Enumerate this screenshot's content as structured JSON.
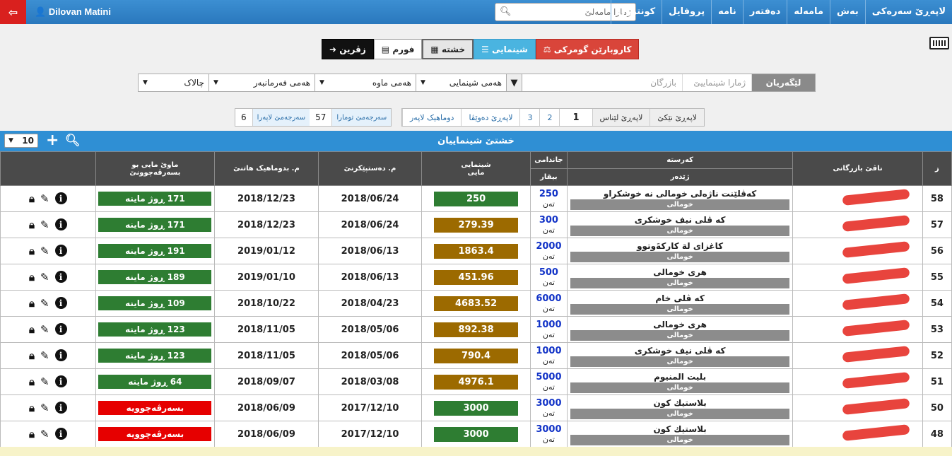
{
  "topnav": {
    "user": "Dilovan Matini",
    "items": [
      "لاپەڕێ سەرەکی",
      "بەش",
      "مامەلە",
      "دەفتەر",
      "نامە",
      "پروفایل",
      "کونترول"
    ],
    "search_placeholder": "ژمارا مامەلێ"
  },
  "buttons": {
    "back": "زڤرین",
    "form": "فورم",
    "table": "خشتە",
    "show": "شینمایی",
    "customs": "کاروبارێن گومرکی"
  },
  "filters": {
    "search_btn": "لێگەریان",
    "show_no_placeholder": "ژمارا شینماییێ",
    "merchant_placeholder": "بازرگان",
    "all_show": "هەمی شینمایی",
    "all_period": "هەمی ماوە",
    "all_director": "هەمی فەرمانبەر",
    "status": "چالاک"
  },
  "pager": {
    "next": "لاپەڕێ نێکێ",
    "prev": "لاپەڕێ لێناس",
    "pages": [
      "1",
      "2",
      "3"
    ],
    "last_prev": "لاپەڕێ دەوێڤا",
    "last": "دوماهیک لاپەر"
  },
  "stats": {
    "total_records_label": "سەرجەمێ تومارا",
    "total_records": "57",
    "total_pages_label": "سەرجەمێ لاپەرا",
    "total_pages": "6"
  },
  "panel": {
    "title": "خشتێ شینماییان",
    "page_size": "10"
  },
  "columns": {
    "num": "ز",
    "merchant": "ناڤێ بازرگانی",
    "goods": "کەرستە",
    "goods_sub": "ژێدەر",
    "qty": "جاندامی",
    "qty_sub": "بیقار",
    "color": "شینمایی",
    "color_sub": "مایی",
    "start": "م. دەستپێکرنێ",
    "end": "م. بدوماهیک هاتنێ",
    "remain": "ماوێ مایی بو",
    "remain_sub": "بسەرڤەچوونێ"
  },
  "rows": [
    {
      "num": "58",
      "goods": "کەڤلێنت ناژەلی خومالی نە خوشکراو",
      "type": "خومالی",
      "qty": "250",
      "unit": "تەن",
      "value": "250",
      "color": "#2e7d32",
      "start": "2018/06/24",
      "end": "2018/12/23",
      "remain": "171 ڕوژ ماینە",
      "remain_color": "#2e7d32"
    },
    {
      "num": "57",
      "goods": "کە ڤلی نیف خوشکری",
      "type": "خومالی",
      "qty": "300",
      "unit": "تەن",
      "value": "279.39",
      "color": "#9c6a00",
      "start": "2018/06/24",
      "end": "2018/12/23",
      "remain": "171 ڕوژ ماینە",
      "remain_color": "#2e7d32"
    },
    {
      "num": "56",
      "goods": "کاغزای لەَ کارکةَوتوو",
      "type": "خومالی",
      "qty": "2000",
      "unit": "تەن",
      "value": "1863.4",
      "color": "#9c6a00",
      "start": "2018/06/13",
      "end": "2019/01/12",
      "remain": "191 ڕوژ ماینە",
      "remain_color": "#2e7d32"
    },
    {
      "num": "55",
      "goods": "هری خومالی",
      "type": "خومالی",
      "qty": "500",
      "unit": "تەن",
      "value": "451.96",
      "color": "#9c6a00",
      "start": "2018/06/13",
      "end": "2019/01/10",
      "remain": "189 ڕوژ ماینە",
      "remain_color": "#2e7d32"
    },
    {
      "num": "54",
      "goods": "کە ڤلی خام",
      "type": "خومالی",
      "qty": "6000",
      "unit": "تەن",
      "value": "4683.52",
      "color": "#9c6a00",
      "start": "2018/04/23",
      "end": "2018/10/22",
      "remain": "109 ڕوژ ماینە",
      "remain_color": "#2e7d32"
    },
    {
      "num": "53",
      "goods": "هری خومالی",
      "type": "خومالی",
      "qty": "1000",
      "unit": "تەن",
      "value": "892.38",
      "color": "#9c6a00",
      "start": "2018/05/06",
      "end": "2018/11/05",
      "remain": "123 ڕوژ ماینە",
      "remain_color": "#2e7d32"
    },
    {
      "num": "52",
      "goods": "کە ڤلی نیف خوشکری",
      "type": "خومالی",
      "qty": "1000",
      "unit": "تەن",
      "value": "790.4",
      "color": "#9c6a00",
      "start": "2018/05/06",
      "end": "2018/11/05",
      "remain": "123 ڕوژ ماینە",
      "remain_color": "#2e7d32"
    },
    {
      "num": "51",
      "goods": "بليت المنيوم",
      "type": "خومالی",
      "qty": "5000",
      "unit": "تەن",
      "value": "4976.1",
      "color": "#9c6a00",
      "start": "2018/03/08",
      "end": "2018/09/07",
      "remain": "64 ڕوژ ماینە",
      "remain_color": "#2e7d32"
    },
    {
      "num": "50",
      "goods": "بلاستيك كون",
      "type": "خومالی",
      "qty": "3000",
      "unit": "تەن",
      "value": "3000",
      "color": "#2e7d32",
      "start": "2017/12/10",
      "end": "2018/06/09",
      "remain": "بسەرڤەچوویە",
      "remain_color": "#e60000"
    },
    {
      "num": "48",
      "goods": "بلاستيك كون",
      "type": "خومالی",
      "qty": "3000",
      "unit": "تەن",
      "value": "3000",
      "color": "#2e7d32",
      "start": "2017/12/10",
      "end": "2018/06/09",
      "remain": "بسەرڤەچوویە",
      "remain_color": "#e60000"
    }
  ]
}
